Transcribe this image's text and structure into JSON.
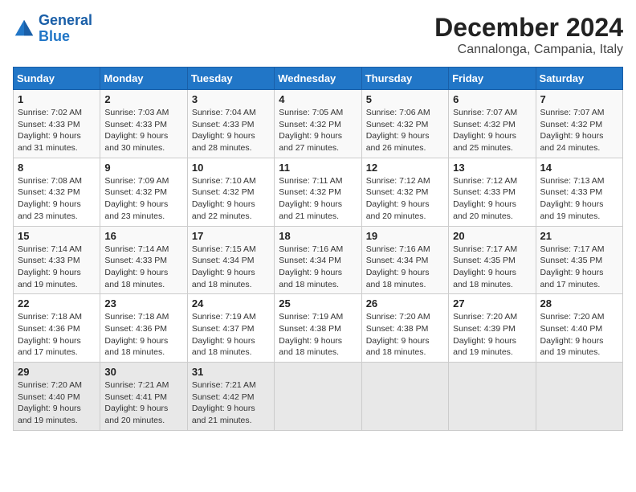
{
  "logo": {
    "text_general": "General",
    "text_blue": "Blue"
  },
  "title": "December 2024",
  "subtitle": "Cannalonga, Campania, Italy",
  "headers": [
    "Sunday",
    "Monday",
    "Tuesday",
    "Wednesday",
    "Thursday",
    "Friday",
    "Saturday"
  ],
  "weeks": [
    [
      {
        "day": "1",
        "info": "Sunrise: 7:02 AM\nSunset: 4:33 PM\nDaylight: 9 hours\nand 31 minutes."
      },
      {
        "day": "2",
        "info": "Sunrise: 7:03 AM\nSunset: 4:33 PM\nDaylight: 9 hours\nand 30 minutes."
      },
      {
        "day": "3",
        "info": "Sunrise: 7:04 AM\nSunset: 4:33 PM\nDaylight: 9 hours\nand 28 minutes."
      },
      {
        "day": "4",
        "info": "Sunrise: 7:05 AM\nSunset: 4:32 PM\nDaylight: 9 hours\nand 27 minutes."
      },
      {
        "day": "5",
        "info": "Sunrise: 7:06 AM\nSunset: 4:32 PM\nDaylight: 9 hours\nand 26 minutes."
      },
      {
        "day": "6",
        "info": "Sunrise: 7:07 AM\nSunset: 4:32 PM\nDaylight: 9 hours\nand 25 minutes."
      },
      {
        "day": "7",
        "info": "Sunrise: 7:07 AM\nSunset: 4:32 PM\nDaylight: 9 hours\nand 24 minutes."
      }
    ],
    [
      {
        "day": "8",
        "info": "Sunrise: 7:08 AM\nSunset: 4:32 PM\nDaylight: 9 hours\nand 23 minutes."
      },
      {
        "day": "9",
        "info": "Sunrise: 7:09 AM\nSunset: 4:32 PM\nDaylight: 9 hours\nand 23 minutes."
      },
      {
        "day": "10",
        "info": "Sunrise: 7:10 AM\nSunset: 4:32 PM\nDaylight: 9 hours\nand 22 minutes."
      },
      {
        "day": "11",
        "info": "Sunrise: 7:11 AM\nSunset: 4:32 PM\nDaylight: 9 hours\nand 21 minutes."
      },
      {
        "day": "12",
        "info": "Sunrise: 7:12 AM\nSunset: 4:32 PM\nDaylight: 9 hours\nand 20 minutes."
      },
      {
        "day": "13",
        "info": "Sunrise: 7:12 AM\nSunset: 4:33 PM\nDaylight: 9 hours\nand 20 minutes."
      },
      {
        "day": "14",
        "info": "Sunrise: 7:13 AM\nSunset: 4:33 PM\nDaylight: 9 hours\nand 19 minutes."
      }
    ],
    [
      {
        "day": "15",
        "info": "Sunrise: 7:14 AM\nSunset: 4:33 PM\nDaylight: 9 hours\nand 19 minutes."
      },
      {
        "day": "16",
        "info": "Sunrise: 7:14 AM\nSunset: 4:33 PM\nDaylight: 9 hours\nand 18 minutes."
      },
      {
        "day": "17",
        "info": "Sunrise: 7:15 AM\nSunset: 4:34 PM\nDaylight: 9 hours\nand 18 minutes."
      },
      {
        "day": "18",
        "info": "Sunrise: 7:16 AM\nSunset: 4:34 PM\nDaylight: 9 hours\nand 18 minutes."
      },
      {
        "day": "19",
        "info": "Sunrise: 7:16 AM\nSunset: 4:34 PM\nDaylight: 9 hours\nand 18 minutes."
      },
      {
        "day": "20",
        "info": "Sunrise: 7:17 AM\nSunset: 4:35 PM\nDaylight: 9 hours\nand 18 minutes."
      },
      {
        "day": "21",
        "info": "Sunrise: 7:17 AM\nSunset: 4:35 PM\nDaylight: 9 hours\nand 17 minutes."
      }
    ],
    [
      {
        "day": "22",
        "info": "Sunrise: 7:18 AM\nSunset: 4:36 PM\nDaylight: 9 hours\nand 17 minutes."
      },
      {
        "day": "23",
        "info": "Sunrise: 7:18 AM\nSunset: 4:36 PM\nDaylight: 9 hours\nand 18 minutes."
      },
      {
        "day": "24",
        "info": "Sunrise: 7:19 AM\nSunset: 4:37 PM\nDaylight: 9 hours\nand 18 minutes."
      },
      {
        "day": "25",
        "info": "Sunrise: 7:19 AM\nSunset: 4:38 PM\nDaylight: 9 hours\nand 18 minutes."
      },
      {
        "day": "26",
        "info": "Sunrise: 7:20 AM\nSunset: 4:38 PM\nDaylight: 9 hours\nand 18 minutes."
      },
      {
        "day": "27",
        "info": "Sunrise: 7:20 AM\nSunset: 4:39 PM\nDaylight: 9 hours\nand 19 minutes."
      },
      {
        "day": "28",
        "info": "Sunrise: 7:20 AM\nSunset: 4:40 PM\nDaylight: 9 hours\nand 19 minutes."
      }
    ],
    [
      {
        "day": "29",
        "info": "Sunrise: 7:20 AM\nSunset: 4:40 PM\nDaylight: 9 hours\nand 19 minutes."
      },
      {
        "day": "30",
        "info": "Sunrise: 7:21 AM\nSunset: 4:41 PM\nDaylight: 9 hours\nand 20 minutes."
      },
      {
        "day": "31",
        "info": "Sunrise: 7:21 AM\nSunset: 4:42 PM\nDaylight: 9 hours\nand 21 minutes."
      },
      null,
      null,
      null,
      null
    ]
  ]
}
